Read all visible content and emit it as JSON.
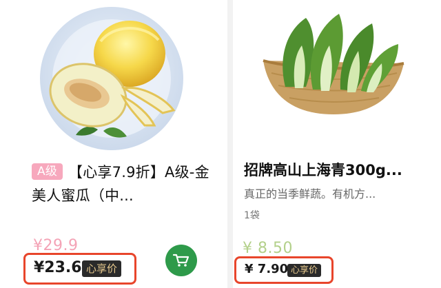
{
  "products": [
    {
      "grade_badge": "A级",
      "title": "【心享7.9折】A级-金美人蜜瓜（中...",
      "original_price": "¥29.9",
      "member_price": "¥23.6",
      "member_tag": "心享价",
      "image_icon": "cantaloupe-plate-icon",
      "cart_icon": "cart-icon",
      "accent_color": "#2e9a4a"
    },
    {
      "title": "招牌高山上海青300g...",
      "description": "真正的当季鲜蔬。有机方...",
      "unit": "1袋",
      "original_price": "¥ 8.50",
      "member_price": "¥ 7.90",
      "member_tag": "心享价",
      "image_icon": "bok-choy-basket-icon",
      "cart_icon": "cart-icon",
      "accent_color": "#77b83c"
    }
  ]
}
